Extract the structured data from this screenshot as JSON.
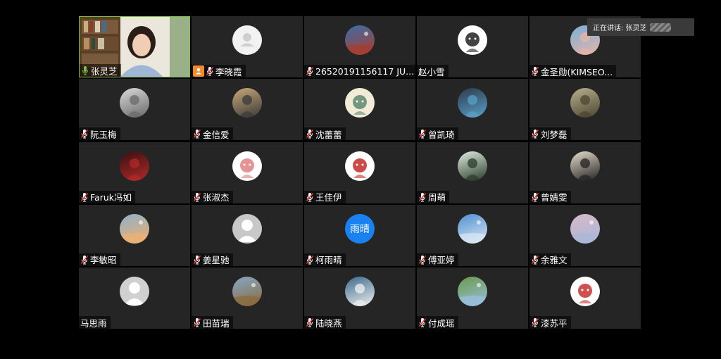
{
  "speaking_label": "正在讲话: 张灵芝",
  "participants": [
    {
      "name": "张灵芝",
      "mic": "on",
      "avatar": "video",
      "active": true
    },
    {
      "name": "李晓霞",
      "mic": "muted",
      "avatar": "default-person",
      "host": true
    },
    {
      "name": "26520191156117 JU...",
      "mic": "muted",
      "avatar": "photo-bridge",
      "colors": [
        "#3b6ea8",
        "#a93c2e"
      ]
    },
    {
      "name": "赵小雪",
      "mic": "none",
      "avatar": "cartoon-character",
      "colors": [
        "#ffffff",
        "#222222"
      ]
    },
    {
      "name": "金圣勋(KIMSEO...",
      "mic": "muted",
      "avatar": "photo-person",
      "colors": [
        "#7ab0d8",
        "#e7b4a8"
      ]
    },
    {
      "name": "阮玉梅",
      "mic": "muted",
      "avatar": "photo-person",
      "colors": [
        "#d9d9d9",
        "#6a6a6a"
      ]
    },
    {
      "name": "金信爱",
      "mic": "muted",
      "avatar": "photo-person",
      "colors": [
        "#c9a877",
        "#3a3a3a"
      ]
    },
    {
      "name": "沈蕾蕾",
      "mic": "muted",
      "avatar": "cartoon-couple",
      "colors": [
        "#f2ebd8",
        "#5e8a6e"
      ]
    },
    {
      "name": "曾凯琦",
      "mic": "muted",
      "avatar": "photo-dark",
      "colors": [
        "#2b3a4a",
        "#5aa0c8"
      ]
    },
    {
      "name": "刘梦磊",
      "mic": "muted",
      "avatar": "photo-person",
      "colors": [
        "#b8b08f",
        "#4d4530"
      ]
    },
    {
      "name": "Faruk冯如",
      "mic": "muted",
      "avatar": "photo-night",
      "colors": [
        "#3a1010",
        "#b02a2a"
      ]
    },
    {
      "name": "张淑杰",
      "mic": "muted",
      "avatar": "cartoon-face",
      "colors": [
        "#ffffff",
        "#e08080"
      ]
    },
    {
      "name": "王佳伊",
      "mic": "muted",
      "avatar": "cartoon-doll",
      "colors": [
        "#ffffff",
        "#c42c2c"
      ]
    },
    {
      "name": "周萌",
      "mic": "muted",
      "avatar": "photo-person",
      "colors": [
        "#dfeee0",
        "#2a3a2a"
      ]
    },
    {
      "name": "曾婧雯",
      "mic": "muted",
      "avatar": "photo-person",
      "colors": [
        "#e7dccc",
        "#222222"
      ]
    },
    {
      "name": "李敏昭",
      "mic": "muted",
      "avatar": "photo-sky",
      "colors": [
        "#8fb0c8",
        "#f0b070"
      ]
    },
    {
      "name": "姜星驰",
      "mic": "muted",
      "avatar": "default-gray",
      "colors": [
        "#c8c8c8",
        "#9a9a9a"
      ]
    },
    {
      "name": "柯雨晴",
      "mic": "muted",
      "avatar": "text",
      "text": "雨晴",
      "colors": [
        "#1a82f0"
      ]
    },
    {
      "name": "傅亚婷",
      "mic": "muted",
      "avatar": "photo-sky",
      "colors": [
        "#4f8fd0",
        "#dbe8f5"
      ]
    },
    {
      "name": "余雅文",
      "mic": "muted",
      "avatar": "photo-sky",
      "colors": [
        "#d9b8c8",
        "#a8b8d8"
      ]
    },
    {
      "name": "马思雨",
      "mic": "none",
      "avatar": "default-gray",
      "colors": [
        "#d0d0d0",
        "#a5a5a5"
      ]
    },
    {
      "name": "田苗瑞",
      "mic": "muted",
      "avatar": "photo-street",
      "colors": [
        "#86a8c8",
        "#8a6a3a"
      ]
    },
    {
      "name": "陆晓燕",
      "mic": "muted",
      "avatar": "photo-person",
      "colors": [
        "#3a6a8a",
        "#f0f0f0"
      ]
    },
    {
      "name": "付成瑶",
      "mic": "muted",
      "avatar": "photo-field",
      "colors": [
        "#6a9a4a",
        "#9ac0e0"
      ]
    },
    {
      "name": "漆苏平",
      "mic": "muted",
      "avatar": "cartoon-girl",
      "colors": [
        "#ffffff",
        "#c83030"
      ]
    }
  ]
}
